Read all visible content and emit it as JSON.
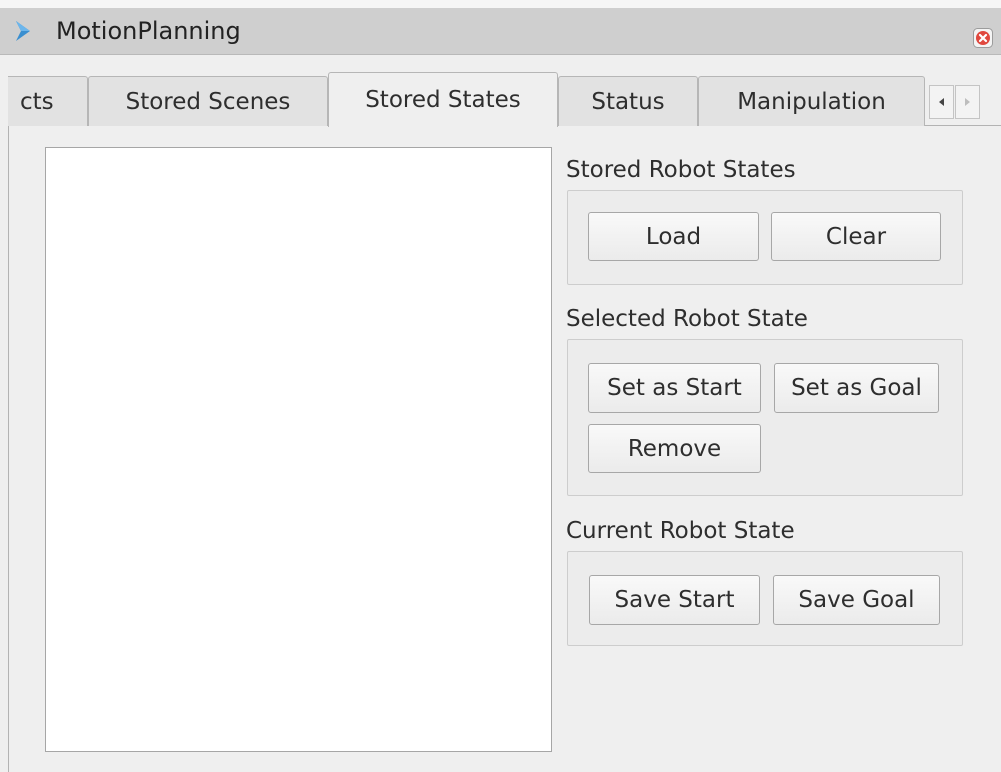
{
  "window": {
    "title": "MotionPlanning",
    "title_icon": "chevron-right-icon",
    "close_icon": "close-icon",
    "close_color": "#e0483e"
  },
  "tabs": [
    {
      "label": "cts",
      "active": false
    },
    {
      "label": "Stored Scenes",
      "active": false
    },
    {
      "label": "Stored States",
      "active": true
    },
    {
      "label": "Status",
      "active": false
    },
    {
      "label": "Manipulation",
      "active": false
    }
  ],
  "tab_scroll": {
    "left_icon": "caret-left-icon",
    "right_icon": "caret-right-icon"
  },
  "stored_robot_states": {
    "title": "Stored Robot States",
    "load_label": "Load",
    "clear_label": "Clear"
  },
  "selected_robot_state": {
    "title": "Selected Robot State",
    "set_start_label": "Set as Start",
    "set_goal_label": "Set as Goal",
    "remove_label": "Remove"
  },
  "current_robot_state": {
    "title": "Current Robot State",
    "save_start_label": "Save Start",
    "save_goal_label": "Save Goal"
  }
}
